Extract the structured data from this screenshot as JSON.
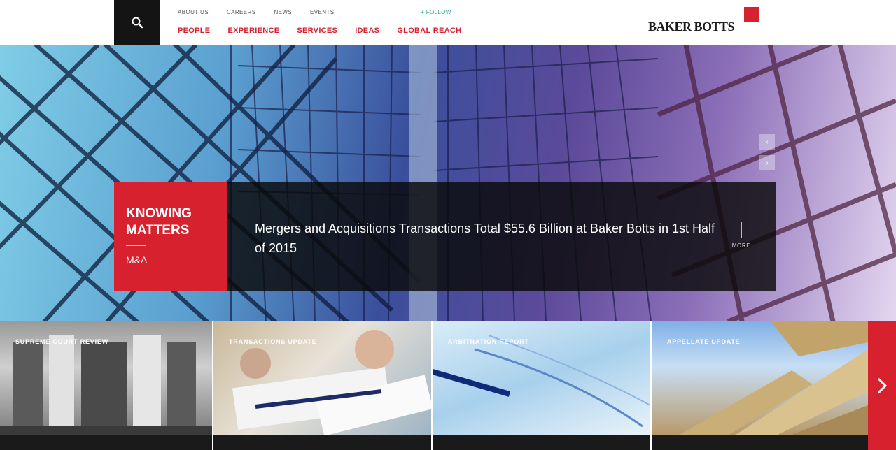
{
  "header": {
    "search_icon": "search-icon",
    "utility_nav": [
      "ABOUT US",
      "CAREERS",
      "NEWS",
      "EVENTS"
    ],
    "follow_label": "+ FOLLOW",
    "main_nav": [
      "PEOPLE",
      "EXPERIENCE",
      "SERVICES",
      "IDEAS",
      "GLOBAL REACH"
    ],
    "logo_text": "BAKER BOTTS"
  },
  "hero": {
    "feature_title": "KNOWING MATTERS",
    "feature_tag": "M&A",
    "headline": "Mergers and Acquisitions Transactions Total $55.6 Billion at Baker Botts in 1st Half of 2015",
    "more_label": "MORE",
    "arrow_up": "‹",
    "arrow_down": "›"
  },
  "tiles": [
    {
      "label": "SUPREME COURT REVIEW"
    },
    {
      "label": "TRANSACTIONS UPDATE"
    },
    {
      "label": "ARBITRATION REPORT"
    },
    {
      "label": "APPELLATE UPDATE"
    }
  ],
  "next_arrow": "›",
  "colors": {
    "brand_red": "#d8212f",
    "follow_teal": "#2aa4a0",
    "dark": "#141414"
  }
}
